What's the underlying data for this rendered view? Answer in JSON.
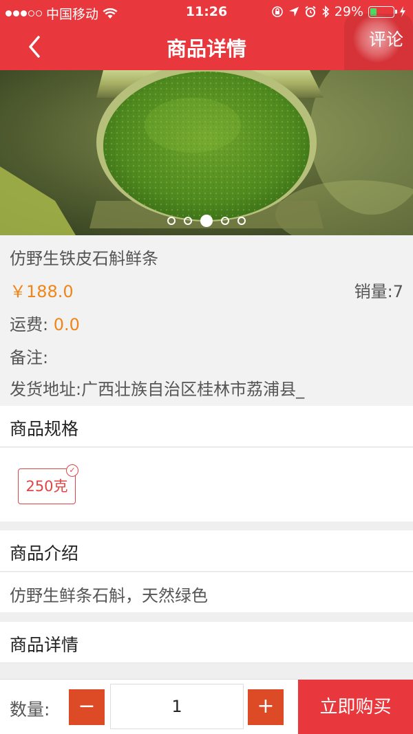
{
  "status_bar": {
    "carrier": "中国移动",
    "time": "11:26",
    "battery_percent": "29%",
    "battery_level": 0.29
  },
  "nav": {
    "title": "商品详情",
    "comment_label": "评论",
    "back_icon": "chevron-left-icon"
  },
  "banner": {
    "page_count": 5,
    "active_index": 2
  },
  "product": {
    "name": "仿野生铁皮石斛鲜条",
    "price": "￥188.0",
    "sales": "销量:7",
    "shipping_label": "运费:",
    "shipping_value": "0.0",
    "remark_label": "备注:",
    "address": "发货地址:广西壮族自治区桂林市荔浦县_"
  },
  "spec": {
    "heading": "商品规格",
    "selected_option": "250克"
  },
  "intro": {
    "heading": "商品介绍",
    "text": "仿野生鲜条石斛，天然绿色"
  },
  "detail": {
    "heading": "商品详情"
  },
  "bottom": {
    "qty_label": "数量:",
    "minus": "−",
    "plus": "+",
    "qty_value": "1",
    "buy_label": "立即购买"
  },
  "colors": {
    "brand_red": "#e8383d",
    "price_orange": "#f08519",
    "qty_button": "#dc4b26"
  }
}
